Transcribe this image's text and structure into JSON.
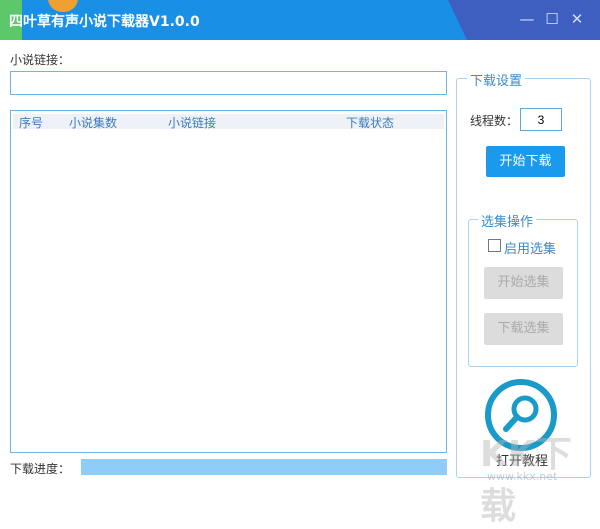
{
  "window": {
    "title": "四叶草有声小说下载器V1.0.0",
    "minimize": "—",
    "maximize": "☐",
    "close": "✕"
  },
  "url_label": "小说链接：",
  "url_value": "",
  "list": {
    "headers": [
      "序号",
      "小说集数",
      "小说链接",
      "下载状态"
    ],
    "rows": []
  },
  "progress": {
    "label": "下载进度：",
    "value": 0
  },
  "settings": {
    "title": "下载设置",
    "threads_label": "线程数：",
    "threads_value": "3",
    "start_download": "开始下载"
  },
  "selection": {
    "title": "选集操作",
    "enable_label": "启用选集",
    "enable_checked": false,
    "start_select": "开始选集",
    "download_select": "下载选集"
  },
  "tutorial": {
    "label": "打开教程"
  },
  "watermark": {
    "text": "KK下载",
    "url": "www.kkx.net"
  }
}
